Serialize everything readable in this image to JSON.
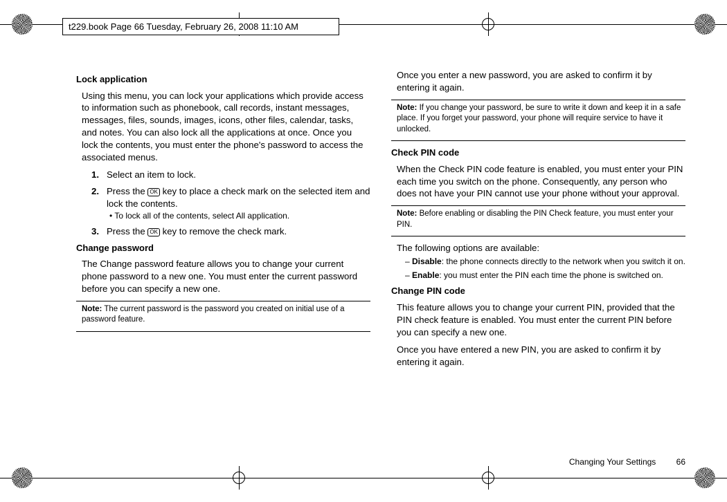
{
  "header": {
    "label": "t229.book  Page 66  Tuesday, February 26, 2008  11:10 AM"
  },
  "left": {
    "h_lock": "Lock application",
    "p_lock": "Using this menu, you can lock your applications which provide access to information such as phonebook, call records, instant messages, messages, files, sounds, images, icons, other files, calendar, tasks, and notes. You can also lock all the applications at once. Once you lock the contents, you must enter the phone's password to access the associated menus.",
    "step1": "Select an item to lock.",
    "step2a": "Press the ",
    "step2b": " key to place a check mark on the selected item and lock the contents.",
    "bullet2": "To lock all of the contents, select All application.",
    "step3a": "Press the ",
    "step3b": " key to remove the check mark.",
    "h_chpw": "Change password",
    "p_chpw": "The Change password feature allows you to change your current phone password to a new one. You must enter the current password before you can specify a new one.",
    "note1_label": "Note:",
    "note1": "The current password is the password you created on initial use of a password feature."
  },
  "right": {
    "p_confirm": "Once you enter a new password, you are asked to confirm it by entering it again.",
    "note1_label": "Note:",
    "note1": "If you change your password, be sure to write it down and keep it in a safe place. If you forget your password, your phone will require service to have it unlocked.",
    "h_checkpin": "Check PIN code",
    "p_checkpin": "When the Check PIN code feature is enabled, you must enter your PIN each time you switch on the phone. Consequently, any person who does not have your PIN cannot use your phone without your approval.",
    "note2_label": "Note:",
    "note2": "Before enabling or disabling the PIN Check feature, you must enter your PIN.",
    "p_options": "The following options are available:",
    "opt_disable_label": "Disable",
    "opt_disable": ": the phone connects directly to the network when you switch it on.",
    "opt_enable_label": "Enable",
    "opt_enable": ": you must enter the PIN each time the phone is switched on.",
    "h_chpin": "Change PIN code",
    "p_chpin": "This feature allows you to change your current PIN, provided that the PIN check feature is enabled. You must enter the current PIN before you can specify a new one.",
    "p_chpin2": "Once you have entered a new PIN, you are asked to confirm it by entering it again."
  },
  "footer": {
    "section": "Changing Your Settings",
    "page": "66"
  },
  "ok_label": "OK"
}
